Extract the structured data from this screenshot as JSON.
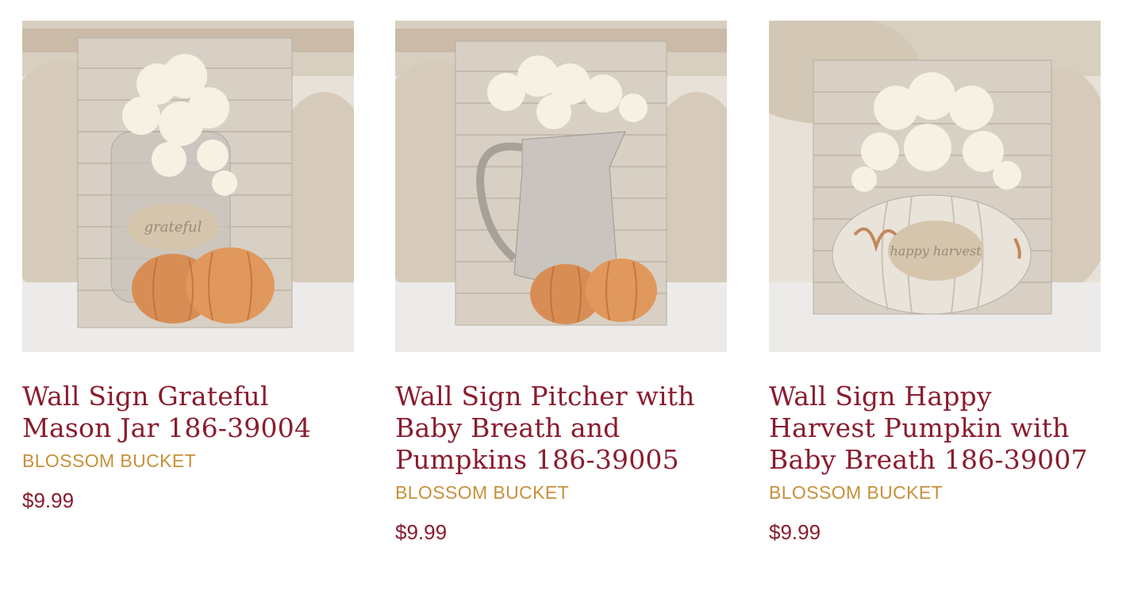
{
  "products": [
    {
      "image_alt": "Wall Sign Grateful Mason Jar",
      "sign_text": "grateful",
      "title": "Wall Sign Grateful Mason Jar 186-39004",
      "vendor": "BLOSSOM BUCKET",
      "price": "$9.99"
    },
    {
      "image_alt": "Wall Sign Pitcher with Baby Breath and Pumpkins",
      "sign_text": "",
      "title": "Wall Sign Pitcher with Baby Breath and Pumpkins 186-39005",
      "vendor": "BLOSSOM BUCKET",
      "price": "$9.99"
    },
    {
      "image_alt": "Wall Sign Happy Harvest Pumpkin with Baby Breath",
      "sign_text": "happy harvest",
      "title": "Wall Sign Happy Harvest Pumpkin with Baby Breath 186-39007",
      "vendor": "BLOSSOM BUCKET",
      "price": "$9.99"
    }
  ],
  "colors": {
    "title": "#8a1c2e",
    "vendor": "#c8903a",
    "price": "#8a1c2e"
  }
}
